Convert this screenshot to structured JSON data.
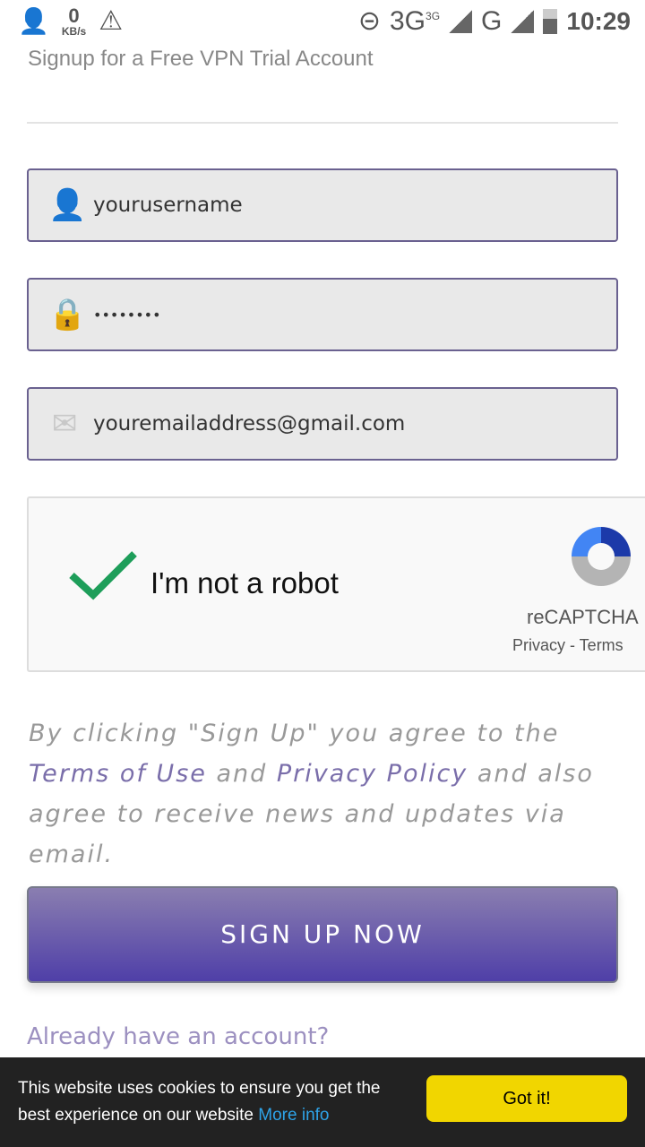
{
  "status_bar": {
    "speed_value": "0",
    "speed_unit": "KB/s",
    "network1": "3G",
    "network1_sup": "3G",
    "network2": "G",
    "time": "10:29"
  },
  "subtitle": "Signup for a Free VPN Trial Account",
  "form": {
    "username": {
      "value": "yourusername",
      "icon": "user-icon"
    },
    "password": {
      "value": "••••••••",
      "icon": "lock-icon"
    },
    "email": {
      "value": "youremailaddress@gmail.com",
      "icon": "envelope-icon"
    }
  },
  "captcha": {
    "label": "I'm not a robot",
    "brand": "reCAPTCHA",
    "privacy": "Privacy - Terms",
    "checked": true,
    "check_color": "#1e9e5a"
  },
  "terms": {
    "prefix": "By clicking \"Sign Up\" you agree to the ",
    "terms_link": "Terms of Use",
    "and": " and ",
    "privacy_link": "Privacy Policy",
    "suffix": " and also agree to receive news and updates via email."
  },
  "signup_button": "SIGN UP NOW",
  "already_link": "Already have an account?",
  "cookie": {
    "message": "This website uses cookies to ensure you get the best experience on our website ",
    "more_info": "More info",
    "button": "Got it!",
    "button_color": "#f1d600"
  }
}
